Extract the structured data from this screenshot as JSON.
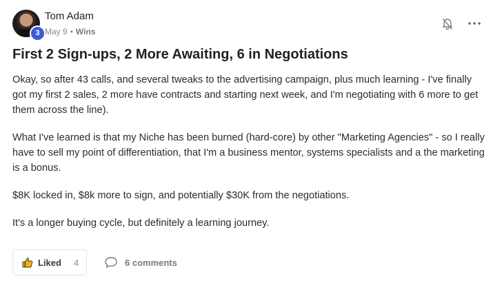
{
  "author": {
    "name": "Tom Adam",
    "level": "3",
    "avatar_icon": "user-avatar-photo"
  },
  "meta": {
    "date": "May 9",
    "separator": "•",
    "category": "Wins"
  },
  "actions": {
    "bell_icon": "bell-icon",
    "more_icon": "more-horizontal-icon"
  },
  "post": {
    "title": "First 2 Sign-ups, 2 More Awaiting, 6 in Negotiations",
    "paragraphs": [
      "Okay, so after 43 calls, and several tweaks to the advertising campaign, plus much learning - I've finally got my first 2 sales, 2 more have contracts and starting next week, and I'm negotiating with 6 more to get them across the line).",
      "What I've learned is that my Niche has been burned (hard-core) by other \"Marketing Agencies\" - so I really have to sell my point of differentiation, that I'm a business mentor, systems specialists and a the marketing is a bonus.",
      "$8K locked in, $8k more to sign, and potentially $30K from the negotiations.",
      "It's a longer buying cycle, but definitely a learning journey."
    ]
  },
  "footer": {
    "like_label": "Liked",
    "like_count": "4",
    "comments_label": "6 comments"
  },
  "colors": {
    "level_badge": "#3b5bdb",
    "title_text": "#202124",
    "muted_text": "#8a8a8a"
  }
}
